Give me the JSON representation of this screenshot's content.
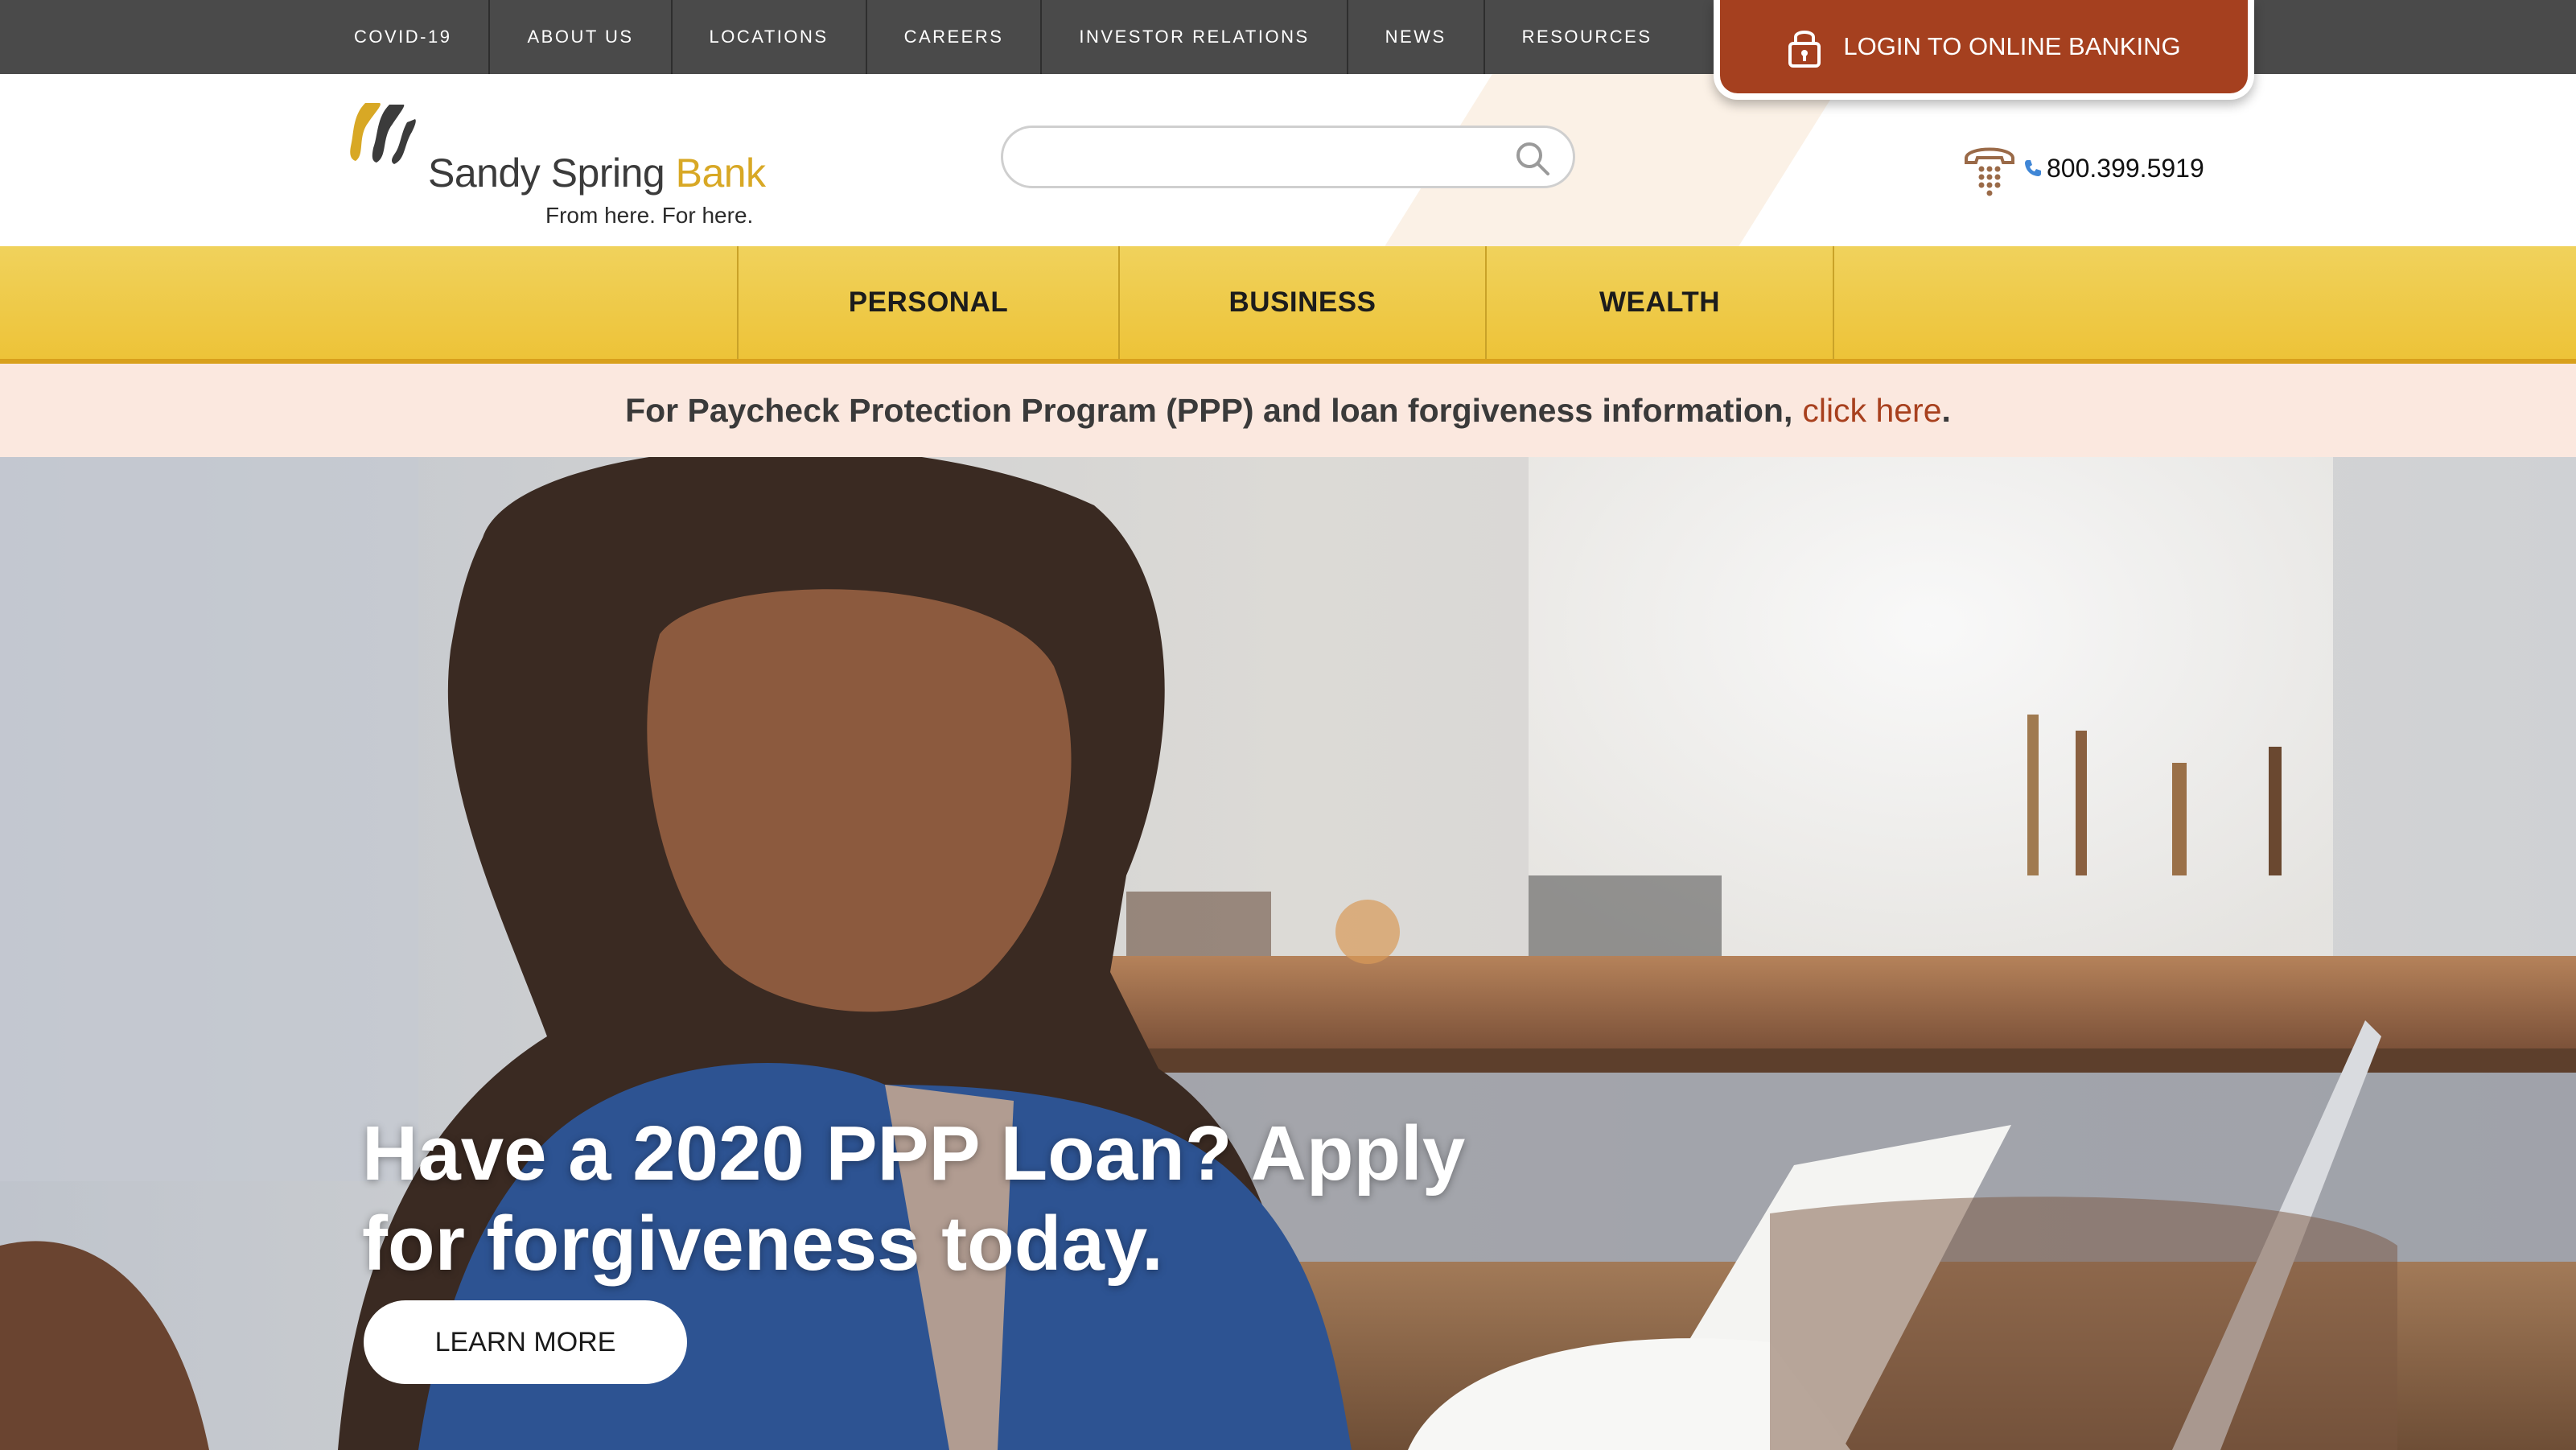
{
  "top_nav": {
    "items": [
      "COVID-19",
      "ABOUT US",
      "LOCATIONS",
      "CAREERS",
      "INVESTOR RELATIONS",
      "NEWS",
      "RESOURCES"
    ]
  },
  "login": {
    "label": "LOGIN TO ONLINE BANKING",
    "icon": "lock-icon"
  },
  "brand": {
    "name_main": "Sandy Spring ",
    "name_accent": "Bank",
    "tagline": "From here. For here.",
    "colors": {
      "gold": "#d8a825",
      "dark": "#3b3b3b"
    }
  },
  "search": {
    "placeholder": "",
    "value": "",
    "icon": "search-icon"
  },
  "phone": {
    "number": "800.399.5919",
    "icon": "telephone-icon"
  },
  "main_nav": {
    "items": [
      "PERSONAL",
      "BUSINESS",
      "WEALTH"
    ]
  },
  "alert": {
    "text": "For Paycheck Protection Program (PPP) and loan forgiveness information,",
    "link": "click here",
    "suffix": "."
  },
  "hero": {
    "headline_line1": "Have a 2020 PPP Loan? Apply",
    "headline_line2": "for forgiveness today.",
    "button": "LEARN MORE"
  },
  "colors": {
    "top_bar": "#4a4a4a",
    "login_bg": "#a5401f",
    "nav_gold": "#edc338",
    "alert_bg": "#fbe8df",
    "link_rust": "#a8401e"
  }
}
